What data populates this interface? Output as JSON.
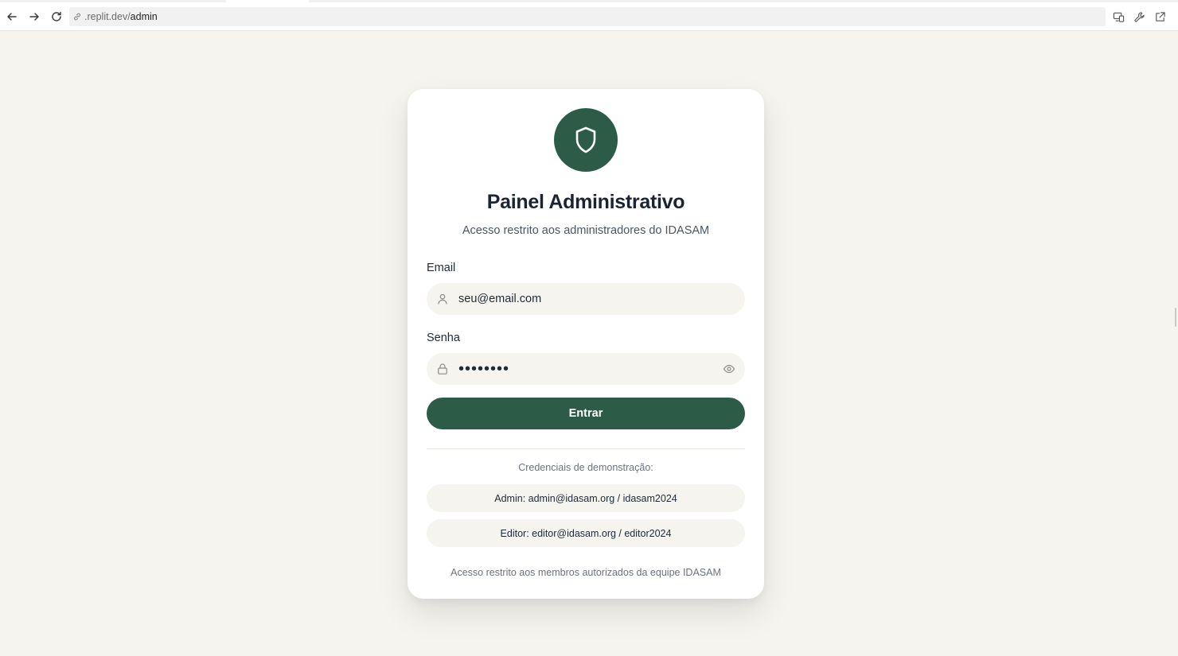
{
  "browser": {
    "url_host": ".replit.dev/",
    "url_path": "admin",
    "icons": [
      "back-arrow-icon",
      "forward-arrow-icon",
      "reload-icon",
      "link-icon",
      "devices-icon",
      "wrench-icon",
      "external-link-icon"
    ]
  },
  "login": {
    "logo_icon": "shield-icon",
    "title": "Painel Administrativo",
    "subtitle": "Acesso restrito aos administradores do IDASAM",
    "email_label": "Email",
    "email_value": "seu@email.com",
    "email_icon": "user-icon",
    "password_label": "Senha",
    "password_value": "••••••••",
    "password_icon": "lock-icon",
    "password_toggle_icon": "eye-icon",
    "submit_label": "Entrar",
    "demo_heading": "Credenciais de demonstração:",
    "demo_credentials": [
      "Admin: admin@idasam.org / idasam2024",
      "Editor: editor@idasam.org / editor2024"
    ],
    "footer_note": "Acesso restrito aos membros autorizados da equipe IDASAM"
  },
  "colors": {
    "brand_green": "#2c5c48",
    "page_background": "#f5f4ef",
    "card_background": "#ffffff"
  }
}
